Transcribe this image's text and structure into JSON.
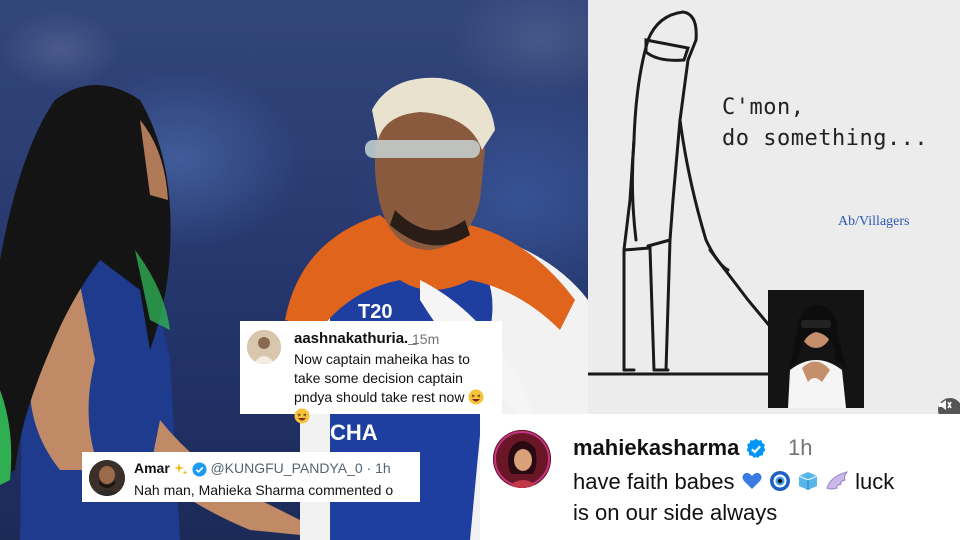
{
  "meme": {
    "caption": "C'mon,\ndo something...",
    "credit": "Ab/Villagers"
  },
  "comments": [
    {
      "username": "aashnakathuria._",
      "time": "15m",
      "text": "Now captain maheika has to take some decision captain pndya should take rest now",
      "emojis": [
        "grinning-squinting-face",
        "grinning-squinting-face"
      ]
    },
    {
      "name": "Amar",
      "badge_emoji": "sparkles",
      "handle": "@KUNGFU_PANDYA_0",
      "time": "· 1h",
      "text": "Nah man, Mahieka Sharma commented o"
    },
    {
      "username": "mahiekasharma",
      "time": "1h",
      "text_start": "have faith babes",
      "emojis": [
        "blue-heart",
        "nazar-amulet",
        "ice-cube",
        "wing"
      ],
      "text_mid": "luck",
      "text_end": "is on our side always"
    }
  ],
  "colors": {
    "verified_blue": "#0095f6",
    "credit_blue": "#2a56b4",
    "jersey_blue": "#1f3fa0",
    "flag_saffron": "#e0641c"
  }
}
